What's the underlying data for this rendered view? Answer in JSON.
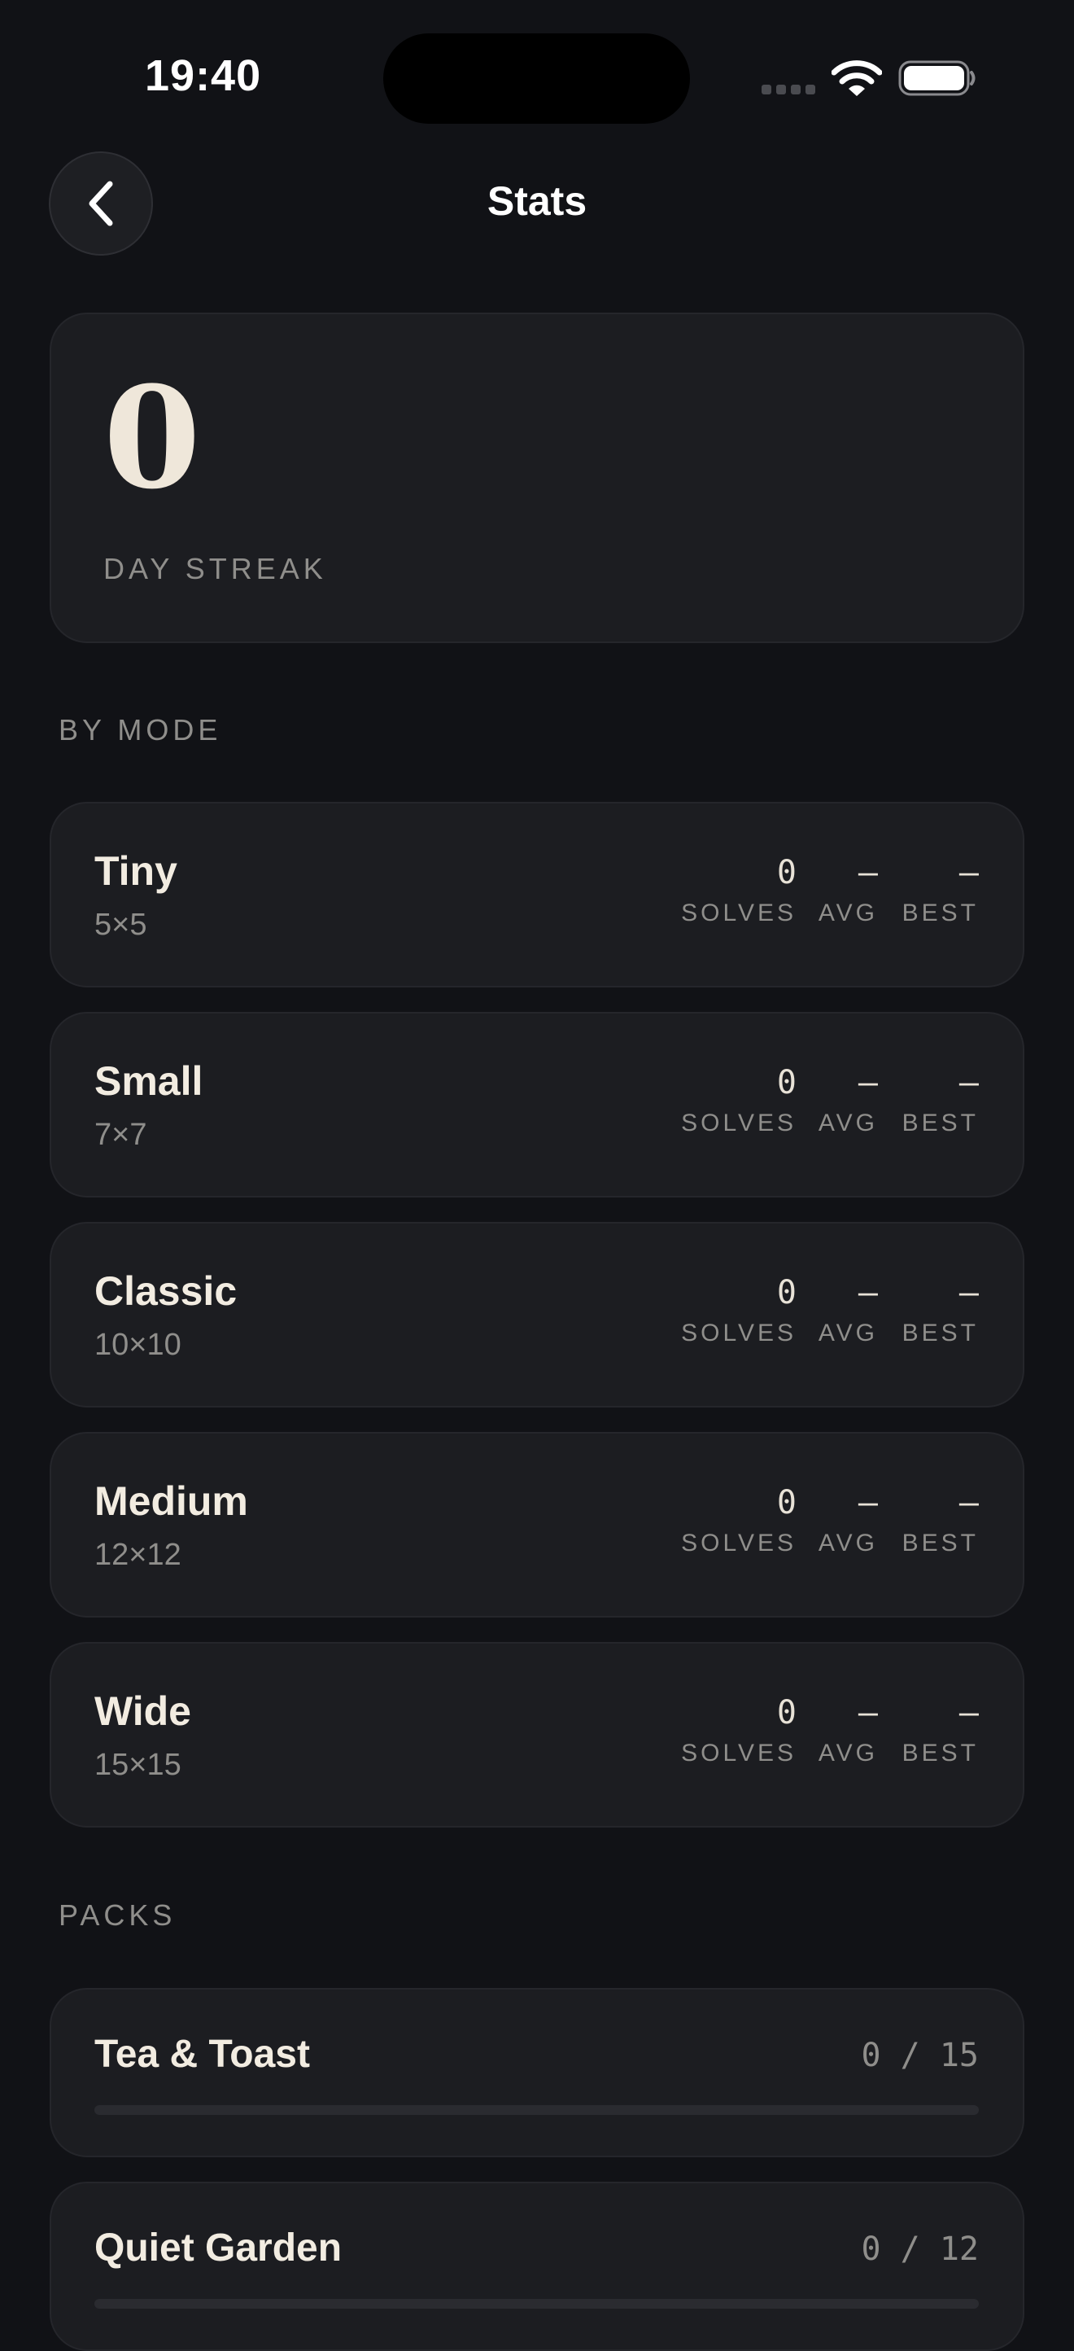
{
  "status_bar": {
    "time": "19:40",
    "icons": [
      "signal-icon",
      "wifi-icon",
      "battery-icon"
    ]
  },
  "header": {
    "title": "Stats",
    "back_icon": "chevron-left-icon"
  },
  "streak": {
    "value": "0",
    "label": "DAY STREAK"
  },
  "by_mode": {
    "heading": "BY MODE",
    "stat_labels": {
      "solves": "SOLVES",
      "avg": "AVG",
      "best": "BEST"
    },
    "modes": [
      {
        "name": "Tiny",
        "size": "5×5",
        "solves": "0",
        "avg": "—",
        "best": "—"
      },
      {
        "name": "Small",
        "size": "7×7",
        "solves": "0",
        "avg": "—",
        "best": "—"
      },
      {
        "name": "Classic",
        "size": "10×10",
        "solves": "0",
        "avg": "—",
        "best": "—"
      },
      {
        "name": "Medium",
        "size": "12×12",
        "solves": "0",
        "avg": "—",
        "best": "—"
      },
      {
        "name": "Wide",
        "size": "15×15",
        "solves": "0",
        "avg": "—",
        "best": "—"
      }
    ]
  },
  "packs": {
    "heading": "PACKS",
    "items": [
      {
        "name": "Tea & Toast",
        "progress_text": "0 / 15",
        "progress": 0
      },
      {
        "name": "Quiet Garden",
        "progress_text": "0 / 12",
        "progress": 0
      }
    ]
  },
  "colors": {
    "background": "#111216",
    "card": "#1c1d21",
    "text_primary": "#f2ece1",
    "text_muted": "#8f8e8b"
  }
}
